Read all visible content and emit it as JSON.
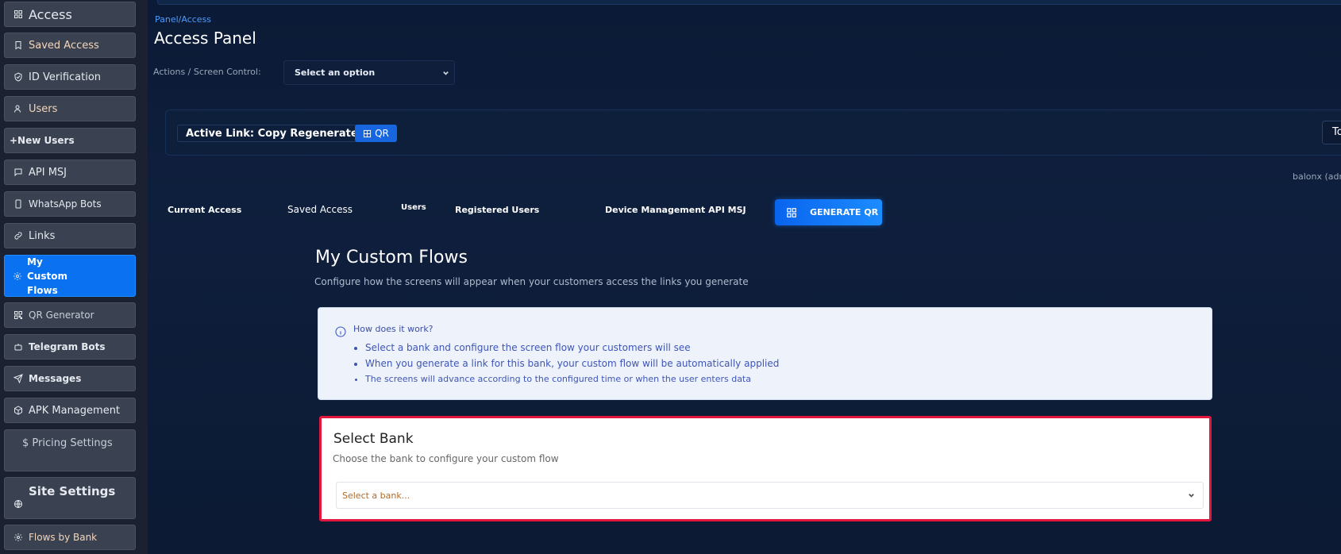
{
  "sidebar": {
    "items": [
      {
        "label": "Access",
        "icon": "grid-icon"
      },
      {
        "label": "Saved Access",
        "icon": "bookmark-icon"
      },
      {
        "label": "ID Verification",
        "icon": "shield-check-icon"
      },
      {
        "label": "Users",
        "icon": "user-icon"
      },
      {
        "label": "+New Users",
        "icon": ""
      },
      {
        "label": "API MSJ",
        "icon": "message-square-icon"
      },
      {
        "label": "WhatsApp Bots",
        "icon": "smartphone-icon"
      },
      {
        "label": "Links",
        "icon": "link-icon"
      },
      {
        "label": "My Custom Flows",
        "icon": "gear-icon"
      },
      {
        "label": "QR Generator",
        "icon": "qr-icon"
      },
      {
        "label": "Telegram Bots",
        "icon": "bot-icon"
      },
      {
        "label": "Messages",
        "icon": "send-icon"
      },
      {
        "label": "APK Management",
        "icon": "package-icon"
      },
      {
        "label": "$ Pricing Settings",
        "icon": ""
      },
      {
        "label": "Site Settings",
        "icon": "globe-icon"
      },
      {
        "label": "Flows by Bank",
        "icon": "gear-icon"
      }
    ]
  },
  "header": {
    "breadcrumb": "Panel/Access",
    "title": "Access Panel",
    "actions_label": "Actions / Screen Control:",
    "actions_select": "Select an option"
  },
  "active_link": {
    "text": "Active Link: Copy Regenerate",
    "qr_label": "QR",
    "right_tab": "To"
  },
  "user_label": "balonx (adm",
  "tabs": {
    "current_access": "Current Access",
    "saved_access": "Saved Access",
    "users": "Users",
    "registered_users": "Registered Users",
    "device_mgmt": "Device Management API MSJ",
    "generate_qr": "GENERATE QR"
  },
  "flows": {
    "title": "My Custom Flows",
    "subtitle": "Configure how the screens will appear when your customers access the links you generate",
    "info_title": "How does it work?",
    "info_items": [
      "Select a bank and configure the screen flow your customers will see",
      "When you generate a link for this bank, your custom flow will be automatically applied",
      "The screens will advance according to the configured time or when the user enters data"
    ]
  },
  "bank": {
    "title": "Select Bank",
    "subtitle": "Choose the bank to configure your custom flow",
    "placeholder": "Select a bank..."
  },
  "colors": {
    "accent": "#0a72f0",
    "highlight_border": "#e3173e",
    "sidebar_bg": "#1b2130"
  }
}
